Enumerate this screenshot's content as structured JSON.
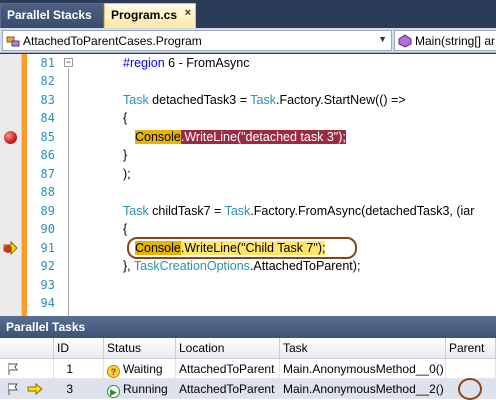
{
  "tabs": [
    {
      "label": "Parallel Stacks"
    },
    {
      "label": "Program.cs",
      "close": "×"
    }
  ],
  "navbar": {
    "left_value": "AttachedToParentCases.Program",
    "right_value": "Main(string[] ar"
  },
  "editor": {
    "fold_marker": "−",
    "line_numbers": [
      "81",
      "82",
      "83",
      "84",
      "85",
      "86",
      "87",
      "88",
      "89",
      "90",
      "91",
      "92",
      "93",
      "94"
    ],
    "lines": {
      "l81": {
        "kw": "#region",
        "text": " 6 - FromAsync"
      },
      "l83": {
        "type1": "Task",
        "mid1": " detachedTask3 = ",
        "type2": "Task",
        "rest": ".Factory.StartNew(() =>"
      },
      "l84": "{",
      "l85": {
        "hl_start": "Console",
        "hl_rest": ".WriteLine(\"detached task 3\");"
      },
      "l86": "}",
      "l87": ");",
      "l89": {
        "type1": "Task",
        "mid1": " childTask7 = ",
        "type2": "Task",
        "rest": ".Factory.FromAsync(detachedTask3, (iar"
      },
      "l90": "{",
      "l91": {
        "hl_start": "Console",
        "hl_rest": ".WriteLine(\"Child Task 7\");"
      },
      "l92": {
        "pre": "}, ",
        "type1": "TaskCreationOptions",
        "rest": ".AttachedToParent);"
      }
    }
  },
  "parallel_tasks": {
    "title": "Parallel Tasks",
    "columns": [
      "ID",
      "Status",
      "Location",
      "Task",
      "Parent"
    ],
    "rows": [
      {
        "id": "1",
        "status": "Waiting",
        "status_glyph": "?",
        "location": "AttachedToParent",
        "task": "Main.AnonymousMethod__0()",
        "parent": "",
        "current": false
      },
      {
        "id": "3",
        "status": "Running",
        "status_glyph": "▶",
        "location": "AttachedToParent",
        "task": "Main.AnonymousMethod__2()",
        "parent": "",
        "current": true
      }
    ]
  },
  "colors": {
    "accent": "#2b3c59",
    "change_bar": "#ff9c29",
    "breakpoint_highlight": "#9b2b45",
    "current_statement": "#ffe66a",
    "annotation_circle": "#8b4513"
  },
  "icons": [
    "close-icon",
    "class-icon",
    "method-icon",
    "dropdown-arrow-icon",
    "outline-collapse-icon",
    "breakpoint-icon",
    "current-statement-icon",
    "flag-icon",
    "current-task-arrow-icon",
    "waiting-status-icon",
    "running-status-icon"
  ]
}
